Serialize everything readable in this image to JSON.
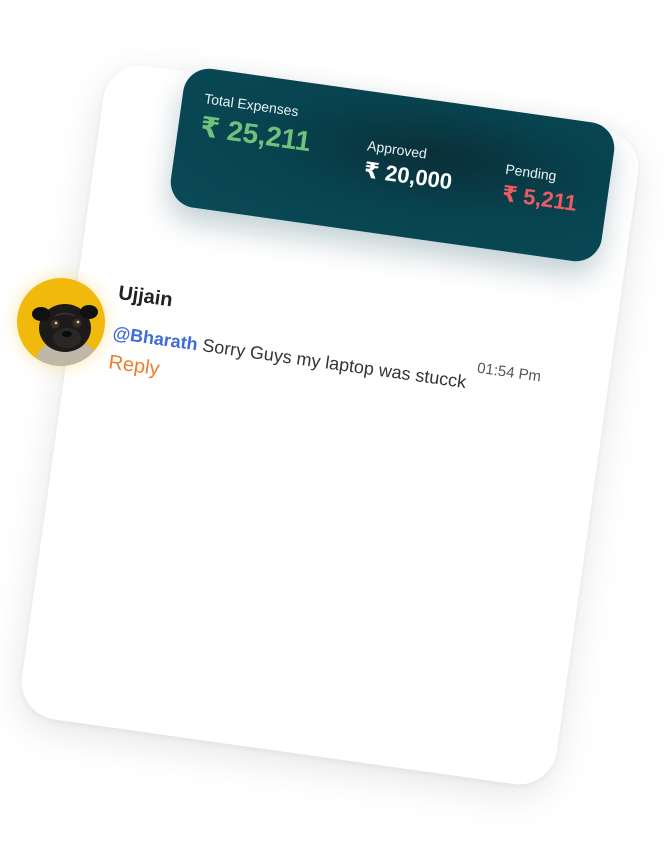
{
  "summary": {
    "total": {
      "label": "Total Expenses",
      "value": "₹ 25,211"
    },
    "approved": {
      "label": "Approved",
      "value": "₹ 20,000"
    },
    "pending": {
      "label": "Pending",
      "value": "₹ 5,211"
    }
  },
  "comment": {
    "author": "Ujjain",
    "mention": "@Bharath",
    "text": "Sorry Guys my laptop was stucck",
    "time": "01:54 Pm",
    "reply_label": "Reply"
  },
  "colors": {
    "panel_bg": "#07434f",
    "total_green": "#6fc27d",
    "pending_red": "#f05a62",
    "mention_blue": "#3f6ad8",
    "reply_orange": "#f07d2b",
    "avatar_bg": "#f0b90c"
  },
  "icons": {
    "avatar": "pug-dog-avatar-icon"
  }
}
